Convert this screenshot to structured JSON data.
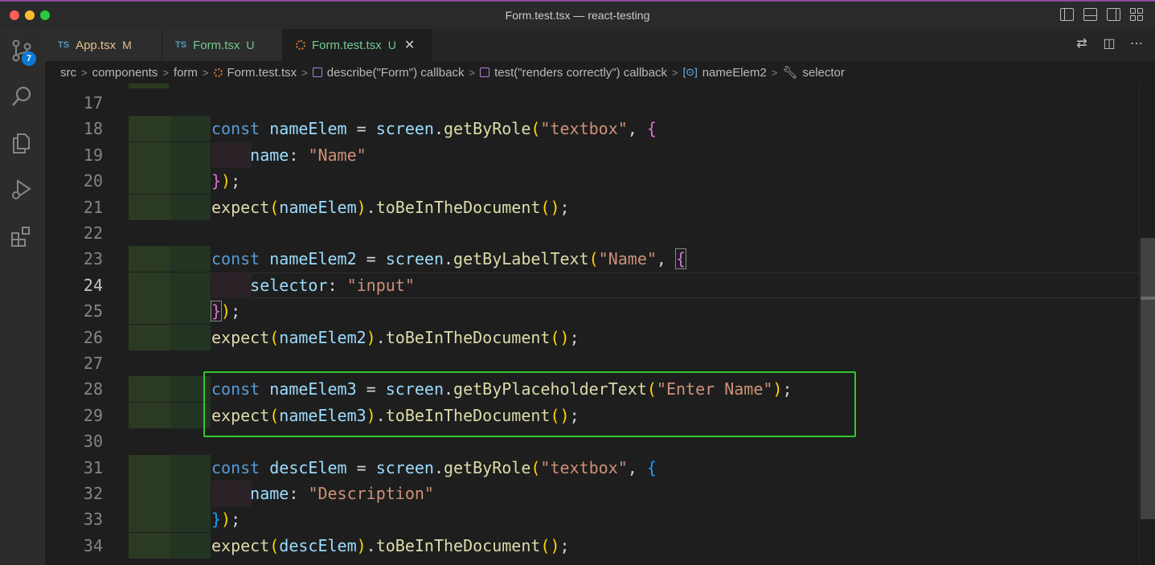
{
  "window": {
    "title": "Form.test.tsx — react-testing"
  },
  "activity": {
    "scm_badge": "7"
  },
  "tabs": [
    {
      "lang": "TS",
      "label": "App.tsx",
      "status": "M"
    },
    {
      "lang": "TS",
      "label": "Form.tsx",
      "status": "U"
    },
    {
      "label": "Form.test.tsx",
      "status": "U",
      "close": "✕"
    }
  ],
  "breadcrumb": {
    "items": [
      "src",
      "components",
      "form",
      "Form.test.tsx",
      "describe(\"Form\") callback",
      "test(\"renders correctly\") callback",
      "nameElem2",
      "selector"
    ]
  },
  "editor": {
    "current_line": "24",
    "lines": [
      {
        "n": "17",
        "tokens": []
      },
      {
        "n": "18",
        "tokens": [
          [
            "k",
            "const "
          ],
          [
            "v",
            "nameElem"
          ],
          [
            "p",
            " = "
          ],
          [
            "v",
            "screen"
          ],
          [
            "p",
            "."
          ],
          [
            "f",
            "getByRole"
          ],
          [
            "b1",
            "("
          ],
          [
            "s",
            "\"textbox\""
          ],
          [
            "p",
            ", "
          ],
          [
            "b2",
            "{"
          ]
        ]
      },
      {
        "n": "19",
        "tokens": [
          [
            "p",
            "    "
          ],
          [
            "v",
            "name"
          ],
          [
            "p",
            ": "
          ],
          [
            "s",
            "\"Name\""
          ]
        ]
      },
      {
        "n": "20",
        "tokens": [
          [
            "b2",
            "}"
          ],
          [
            "b1",
            ")"
          ],
          [
            "p",
            ";"
          ]
        ]
      },
      {
        "n": "21",
        "tokens": [
          [
            "f",
            "expect"
          ],
          [
            "b1",
            "("
          ],
          [
            "v",
            "nameElem"
          ],
          [
            "b1",
            ")"
          ],
          [
            "p",
            "."
          ],
          [
            "f",
            "toBeInTheDocument"
          ],
          [
            "b1",
            "()"
          ],
          [
            "p",
            ";"
          ]
        ]
      },
      {
        "n": "22",
        "tokens": []
      },
      {
        "n": "23",
        "tokens": [
          [
            "k",
            "const "
          ],
          [
            "v",
            "nameElem2"
          ],
          [
            "p",
            " = "
          ],
          [
            "v",
            "screen"
          ],
          [
            "p",
            "."
          ],
          [
            "f",
            "getByLabelText"
          ],
          [
            "b1",
            "("
          ],
          [
            "s",
            "\"Name\""
          ],
          [
            "p",
            ", "
          ],
          [
            "b2",
            "{"
          ]
        ]
      },
      {
        "n": "24",
        "tokens": [
          [
            "p",
            "    "
          ],
          [
            "v",
            "selector"
          ],
          [
            "p",
            ": "
          ],
          [
            "s",
            "\"input\""
          ]
        ]
      },
      {
        "n": "25",
        "tokens": [
          [
            "b2",
            "}"
          ],
          [
            "b1",
            ")"
          ],
          [
            "p",
            ";"
          ]
        ]
      },
      {
        "n": "26",
        "tokens": [
          [
            "f",
            "expect"
          ],
          [
            "b1",
            "("
          ],
          [
            "v",
            "nameElem2"
          ],
          [
            "b1",
            ")"
          ],
          [
            "p",
            "."
          ],
          [
            "f",
            "toBeInTheDocument"
          ],
          [
            "b1",
            "()"
          ],
          [
            "p",
            ";"
          ]
        ]
      },
      {
        "n": "27",
        "tokens": []
      },
      {
        "n": "28",
        "tokens": [
          [
            "k",
            "const "
          ],
          [
            "v",
            "nameElem3"
          ],
          [
            "p",
            " = "
          ],
          [
            "v",
            "screen"
          ],
          [
            "p",
            "."
          ],
          [
            "f",
            "getByPlaceholderText"
          ],
          [
            "b1",
            "("
          ],
          [
            "s",
            "\"Enter Name\""
          ],
          [
            "b1",
            ")"
          ],
          [
            "p",
            ";"
          ]
        ]
      },
      {
        "n": "29",
        "tokens": [
          [
            "f",
            "expect"
          ],
          [
            "b1",
            "("
          ],
          [
            "v",
            "nameElem3"
          ],
          [
            "b1",
            ")"
          ],
          [
            "p",
            "."
          ],
          [
            "f",
            "toBeInTheDocument"
          ],
          [
            "b1",
            "()"
          ],
          [
            "p",
            ";"
          ]
        ]
      },
      {
        "n": "30",
        "tokens": []
      },
      {
        "n": "31",
        "tokens": [
          [
            "k",
            "const "
          ],
          [
            "v",
            "descElem"
          ],
          [
            "p",
            " = "
          ],
          [
            "v",
            "screen"
          ],
          [
            "p",
            "."
          ],
          [
            "f",
            "getByRole"
          ],
          [
            "b1",
            "("
          ],
          [
            "s",
            "\"textbox\""
          ],
          [
            "p",
            ", "
          ],
          [
            "b3",
            "{"
          ]
        ]
      },
      {
        "n": "32",
        "tokens": [
          [
            "p",
            "    "
          ],
          [
            "v",
            "name"
          ],
          [
            "p",
            ": "
          ],
          [
            "s",
            "\"Description\""
          ]
        ]
      },
      {
        "n": "33",
        "tokens": [
          [
            "b3",
            "}"
          ],
          [
            "b1",
            ")"
          ],
          [
            "p",
            ";"
          ]
        ]
      },
      {
        "n": "34",
        "tokens": [
          [
            "f",
            "expect"
          ],
          [
            "b1",
            "("
          ],
          [
            "v",
            "descElem"
          ],
          [
            "b1",
            ")"
          ],
          [
            "p",
            "."
          ],
          [
            "f",
            "toBeInTheDocument"
          ],
          [
            "b1",
            "()"
          ],
          [
            "p",
            ";"
          ]
        ]
      }
    ]
  },
  "colors": {
    "added_gutter": "#2a3a1e",
    "highlight_box": "#31c82f",
    "keyword": "#569cd6",
    "variable": "#9cdcfe",
    "function": "#dcdcaa",
    "string": "#ce9178"
  }
}
